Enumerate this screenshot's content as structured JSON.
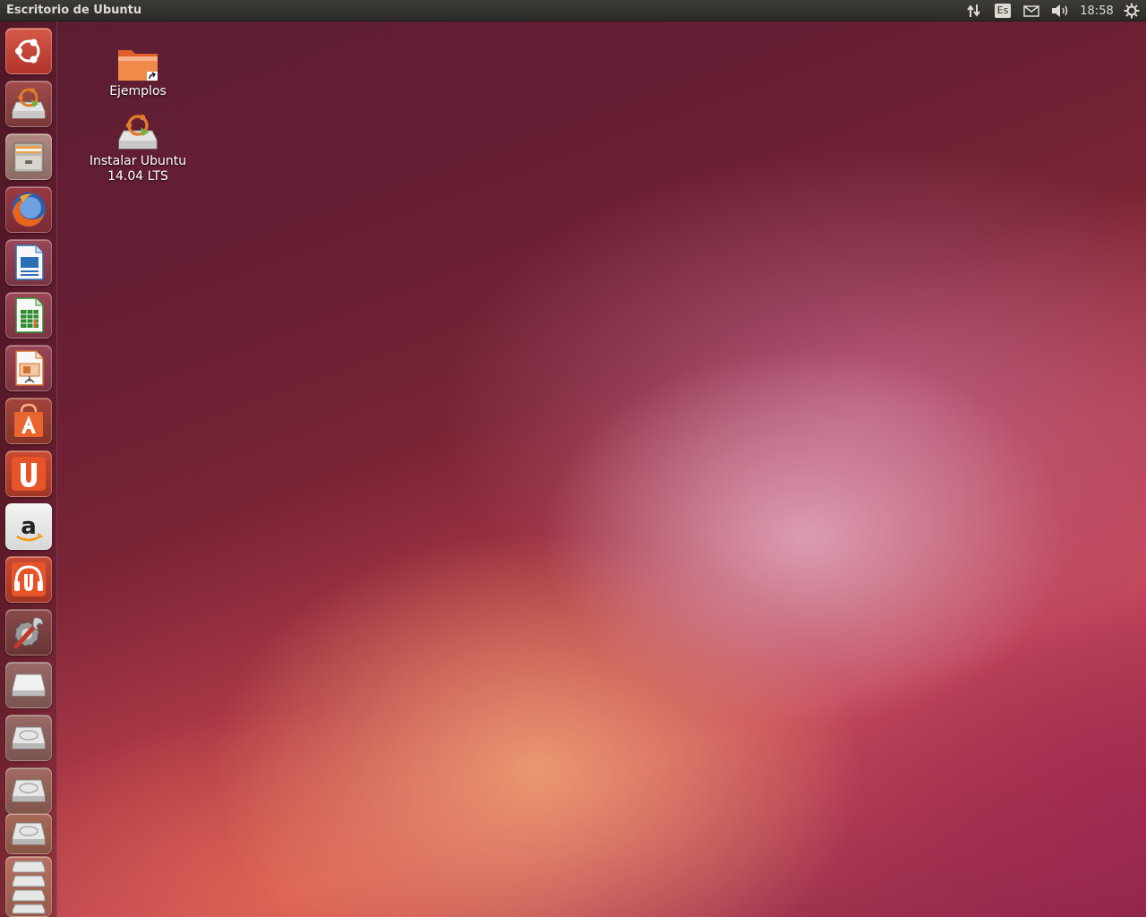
{
  "panel": {
    "title": "Escritorio de Ubuntu",
    "keyboard_layout": "Es",
    "clock": "18:58",
    "indicators": [
      "network-icon",
      "keyboard-layout-indicator",
      "mail-icon",
      "sound-icon",
      "clock",
      "session-gear-icon"
    ]
  },
  "launcher": {
    "items": [
      {
        "name": "ubuntu-dash-icon",
        "color": "#c8453a"
      },
      {
        "name": "ubuntu-installer-icon",
        "color": "#c9b8a8"
      },
      {
        "name": "files-icon",
        "color": "#8e8a84"
      },
      {
        "name": "firefox-icon",
        "color": "#e66000"
      },
      {
        "name": "libreoffice-writer-icon",
        "color": "#2a6fb8"
      },
      {
        "name": "libreoffice-calc-icon",
        "color": "#2e8b2e"
      },
      {
        "name": "libreoffice-impress-icon",
        "color": "#d4702a"
      },
      {
        "name": "software-center-icon",
        "color": "#e8662d"
      },
      {
        "name": "ubuntu-one-icon",
        "color": "#e8542a"
      },
      {
        "name": "amazon-icon",
        "color": "#f2f2f2"
      },
      {
        "name": "ubuntu-one-music-icon",
        "color": "#e8542a"
      },
      {
        "name": "system-settings-icon",
        "color": "#7a7a7a"
      },
      {
        "name": "optical-drive-icon",
        "color": "#d0d0d0"
      },
      {
        "name": "hard-drive-icon",
        "color": "#cfcfcf"
      },
      {
        "name": "hard-drive-icon",
        "color": "#cfcfcf"
      },
      {
        "name": "hard-drive-icon",
        "color": "#cfcfcf"
      },
      {
        "name": "stacked-drives-icon",
        "color": "#cfcfcf"
      }
    ]
  },
  "desktop": {
    "icons": [
      {
        "label": "Ejemplos",
        "icon": "folder-link-icon"
      },
      {
        "label_line1": "Instalar Ubuntu",
        "label_line2": "14.04 LTS",
        "icon": "ubuntu-installer-icon"
      }
    ]
  },
  "colors": {
    "panel": "#2b2a27",
    "panel_text": "#dfdbd2",
    "ubuntu_orange": "#dd4814",
    "wallpaper_dark": "#5a1d33",
    "wallpaper_light": "#e6a8bc"
  }
}
